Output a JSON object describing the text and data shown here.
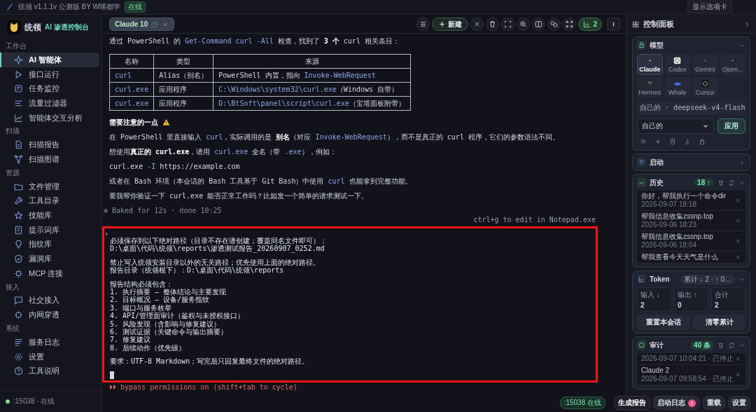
{
  "app": {
    "title": "统领 v1.1.1v 公测版 BY W嗦都学",
    "status": "在线",
    "options_button": "显示选项卡"
  },
  "brand": {
    "name": "统领",
    "subtitle": "AI 渗透控制台"
  },
  "sidebar": [
    {
      "heading": "工作台",
      "items": [
        {
          "label": "AI 智能体",
          "selected": true
        },
        {
          "label": "接口运行",
          "selected": false
        },
        {
          "label": "任务监控",
          "selected": false
        },
        {
          "label": "流量过滤器",
          "selected": false
        },
        {
          "label": "智能体交互分析",
          "selected": false
        }
      ]
    },
    {
      "heading": "扫描",
      "items": [
        {
          "label": "扫描报告",
          "selected": false
        },
        {
          "label": "扫描图谱",
          "selected": false
        }
      ]
    },
    {
      "heading": "资源",
      "items": [
        {
          "label": "文件管理",
          "selected": false
        },
        {
          "label": "工具目录",
          "selected": false
        },
        {
          "label": "技能库",
          "selected": false
        },
        {
          "label": "提示词库",
          "selected": false
        },
        {
          "label": "指纹库",
          "selected": false
        },
        {
          "label": "漏洞库",
          "selected": false
        },
        {
          "label": "MCP 连接",
          "selected": false
        }
      ]
    },
    {
      "heading": "接入",
      "items": [
        {
          "label": "社交接入",
          "selected": false
        },
        {
          "label": "内网穿透",
          "selected": false
        }
      ]
    },
    {
      "heading": "系统",
      "items": [
        {
          "label": "服务日志",
          "selected": false
        },
        {
          "label": "设置",
          "selected": false
        },
        {
          "label": "工具说明",
          "selected": false
        }
      ]
    }
  ],
  "sidebar_status": ":15038 · 在线",
  "session_tab": {
    "label": "Claude 10"
  },
  "toolbar": {
    "new_button": "新建",
    "counter": "2"
  },
  "transcript": {
    "intro": [
      {
        "text": "通过 PowerShell 的 ",
        "kind": "plain"
      },
      {
        "text": "Get-Command curl -All",
        "kind": "code"
      },
      {
        "text": " 检查，找到了 ",
        "kind": "plain"
      },
      {
        "text": "3 个",
        "kind": "bold"
      },
      {
        "text": " curl 相关条目：",
        "kind": "plain"
      }
    ],
    "table": {
      "columns": [
        "名称",
        "类型",
        "来源"
      ],
      "rows": [
        [
          [
            {
              "text": "curl",
              "kind": "code"
            }
          ],
          [
            {
              "text": "Alias（别名）",
              "kind": "plain"
            }
          ],
          [
            {
              "text": "PowerShell 内置，指向 ",
              "kind": "plain"
            },
            {
              "text": "Invoke-WebRequest",
              "kind": "code"
            }
          ]
        ],
        [
          [
            {
              "text": "curl.exe",
              "kind": "code"
            }
          ],
          [
            {
              "text": "应用程序",
              "kind": "plain"
            }
          ],
          [
            {
              "text": "C:\\Windows\\system32\\curl.exe",
              "kind": "code"
            },
            {
              "text": "（Windows 自带）",
              "kind": "plain"
            }
          ]
        ],
        [
          [
            {
              "text": "curl.exe",
              "kind": "code"
            }
          ],
          [
            {
              "text": "应用程序",
              "kind": "plain"
            }
          ],
          [
            {
              "text": "D:\\BtSoft\\panel\\script\\curl.exe",
              "kind": "code"
            },
            {
              "text": "（宝塔面板附带）",
              "kind": "plain"
            }
          ]
        ]
      ]
    },
    "note_heading": "需要注意的一点",
    "paragraphs": [
      [
        {
          "text": "在 PowerShell 里直接输入 ",
          "kind": "plain"
        },
        {
          "text": "curl",
          "kind": "code"
        },
        {
          "text": "，实际调用的是 ",
          "kind": "plain"
        },
        {
          "text": "别名",
          "kind": "bold"
        },
        {
          "text": "（对应 ",
          "kind": "plain"
        },
        {
          "text": "Invoke-WebRequest",
          "kind": "code"
        },
        {
          "text": "），而不是真正的 curl 程序，它们的参数语法不同。",
          "kind": "plain"
        }
      ],
      [
        {
          "text": "想使用",
          "kind": "plain"
        },
        {
          "text": "真正的 curl.exe",
          "kind": "bold"
        },
        {
          "text": "，请用 ",
          "kind": "plain"
        },
        {
          "text": "curl.exe",
          "kind": "code"
        },
        {
          "text": " 全名（带 ",
          "kind": "plain"
        },
        {
          "text": ".exe",
          "kind": "code"
        },
        {
          "text": "），例如：",
          "kind": "plain"
        }
      ],
      [
        {
          "text": "curl.exe ",
          "kind": "plain"
        },
        {
          "text": "-I",
          "kind": "code"
        },
        {
          "text": " https://example.com",
          "kind": "plain"
        }
      ],
      [
        {
          "text": "或者在 Bash 环境（本会话的 Bash 工具基于 Git Bash）中使用 ",
          "kind": "plain"
        },
        {
          "text": "curl",
          "kind": "code"
        },
        {
          "text": " 也能拿到完整功能。",
          "kind": "plain"
        }
      ],
      [
        {
          "text": "要我帮你验证一下 curl.exe 能否正常工作吗？比如发一个简单的请求测试一下。",
          "kind": "plain"
        }
      ]
    ],
    "footer": "✻ Baked for 12s · done 10:25",
    "hint": "ctrl+g to edit in Notepad.exe"
  },
  "prompt": {
    "symbol": "›",
    "blocks": [
      [
        "必须保存到以下绝对路径（目录不存在请创建；覆盖同名文件即可）：",
        "D:\\桌面\\代码\\统领\\reports\\渗透测试报告_20260907_0252.md"
      ],
      [
        "禁止写入统领安装目录以外的无关路径；优先使用上面的绝对路径。",
        "报告目录（统领根下）：D:\\桌面\\代码\\统领\\reports"
      ],
      [
        "报告结构必须包含：",
        "1. 执行摘要 — 整体结论与主要发现",
        "2. 目标概况 — 设备/服务指纹",
        "3. 端口与服务枚举",
        "4. API/管理面审计（鉴权与未授权接口）",
        "5. 风险发现（含影响与修复建议）",
        "6. 测试证据（关键命令与输出摘要）",
        "7. 修复建议",
        "8. 后续动作（优先级）"
      ],
      [
        "要求：UTF-8 Markdown；写完后只回复最终文件的绝对路径。"
      ]
    ]
  },
  "mode_line": "⏵⏵ bypass permissions on (shift+tab to cycle)",
  "panel": {
    "title": "控制面板",
    "model": {
      "title": "模型",
      "tiles": [
        {
          "label": "Claude",
          "selected": true
        },
        {
          "label": "Codex",
          "selected": false
        },
        {
          "label": "Gemini",
          "selected": false
        },
        {
          "label": "Open...",
          "selected": false
        },
        {
          "label": "Hermes",
          "selected": false
        },
        {
          "label": "Whale",
          "selected": false
        },
        {
          "label": "Cursor",
          "selected": false
        }
      ],
      "current": "自己的 · deepseek-v4-flash",
      "select_value": "自己的",
      "apply_button": "应用"
    },
    "startup": {
      "title": "启动"
    },
    "history": {
      "title": "历史",
      "badge": "18 ↑",
      "items": [
        {
          "title": "你好，帮我执行一个命令dir",
          "date": "2026-09-07 18:18"
        },
        {
          "title": "帮我信息收集zssnp.top",
          "date": "2026-09-06 18:23"
        },
        {
          "title": "帮我信息收集zssnp.top",
          "date": "2026-09-06 18:04"
        },
        {
          "title": "帮我查看今天天气是什么"
        }
      ]
    },
    "token": {
      "title": "Token",
      "badge": "累计 ↓ 2 · ↑ 0…",
      "stats": [
        {
          "label": "输入 ↓",
          "value": "2"
        },
        {
          "label": "输出 ↑",
          "value": "0"
        },
        {
          "label": "合计",
          "value": "2"
        }
      ],
      "buttons": [
        "重置本会话",
        "清零累计"
      ]
    },
    "audit": {
      "title": "审计",
      "badge": "40 条",
      "items": [
        {
          "date": "2026-09-07 10:04:21 · 已停止"
        },
        {
          "title": "Claude 2",
          "date": "2026-09-07 09:58:54 · 已停止"
        }
      ]
    }
  },
  "footer_bar": {
    "status": ":15038 在线",
    "buttons": [
      {
        "label": "生成报告",
        "kind": "primary"
      },
      {
        "label": "启动日志",
        "kind": "alert",
        "badge": "!"
      },
      {
        "label": "重载",
        "kind": "plain"
      },
      {
        "label": "设置",
        "kind": "plain"
      }
    ]
  }
}
